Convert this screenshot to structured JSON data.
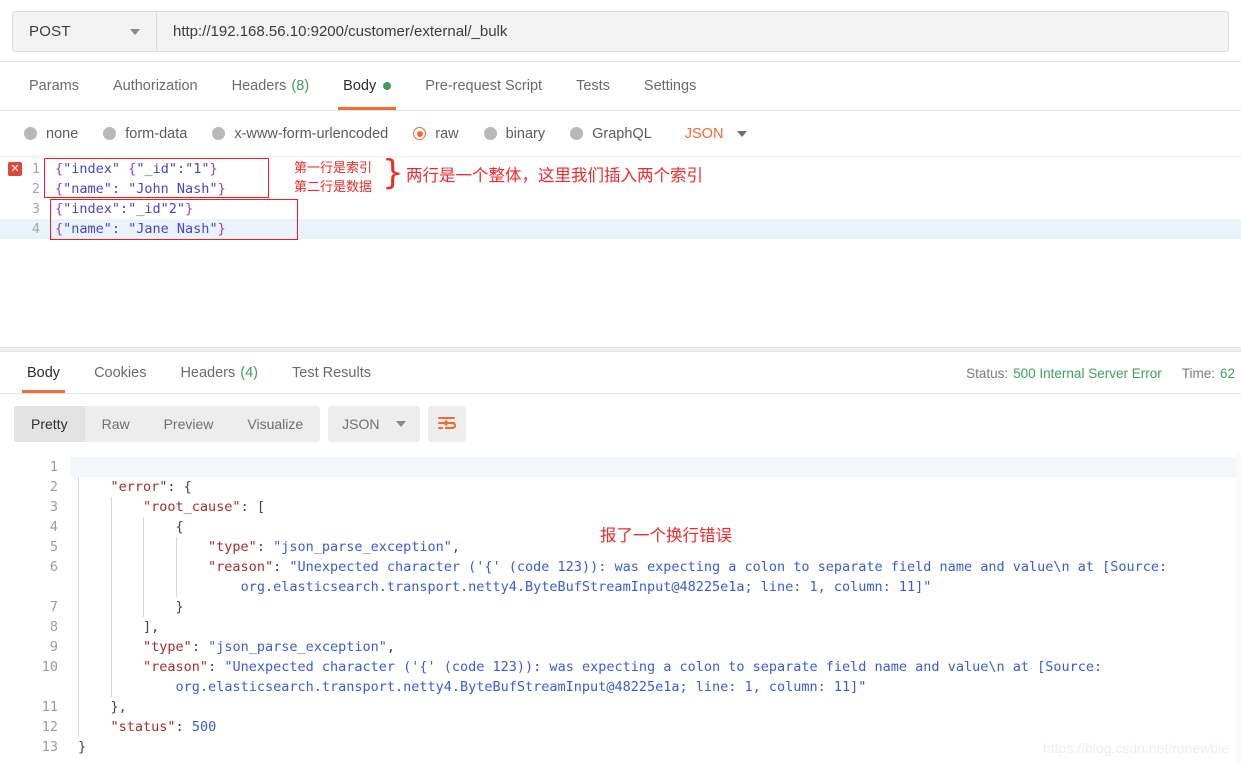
{
  "request": {
    "method": "POST",
    "url": "http://192.168.56.10:9200/customer/external/_bulk",
    "tabs": [
      {
        "label": "Params",
        "active": false,
        "count": null,
        "dot": false
      },
      {
        "label": "Authorization",
        "active": false,
        "count": null,
        "dot": false
      },
      {
        "label": "Headers",
        "active": false,
        "count": "(8)",
        "dot": false
      },
      {
        "label": "Body",
        "active": true,
        "count": null,
        "dot": true
      },
      {
        "label": "Pre-request Script",
        "active": false,
        "count": null,
        "dot": false
      },
      {
        "label": "Tests",
        "active": false,
        "count": null,
        "dot": false
      },
      {
        "label": "Settings",
        "active": false,
        "count": null,
        "dot": false
      }
    ],
    "body_types": [
      {
        "label": "none",
        "selected": false
      },
      {
        "label": "form-data",
        "selected": false
      },
      {
        "label": "x-www-form-urlencoded",
        "selected": false
      },
      {
        "label": "raw",
        "selected": true
      },
      {
        "label": "binary",
        "selected": false
      },
      {
        "label": "GraphQL",
        "selected": false
      }
    ],
    "format_selected": "JSON",
    "editor_lines": [
      {
        "num": "1",
        "text": "{\"index\" {\"_id\":\"1\"}",
        "error": true,
        "highlight": false
      },
      {
        "num": "2",
        "text": "{\"name\": \"John Nash\"}",
        "error": false,
        "highlight": false
      },
      {
        "num": "3",
        "text": "{\"index\":\"_id\"2\"}",
        "error": false,
        "highlight": false
      },
      {
        "num": "4",
        "text": "{\"name\": \"Jane Nash\"}",
        "error": false,
        "highlight": true
      }
    ],
    "annotations": {
      "line1": "第一行是索引",
      "line2": "第二行是数据",
      "brace": "}",
      "main": "两行是一个整体，这里我们插入两个索引"
    }
  },
  "response": {
    "tabs": [
      {
        "label": "Body",
        "active": true,
        "count": null
      },
      {
        "label": "Cookies",
        "active": false,
        "count": null
      },
      {
        "label": "Headers",
        "active": false,
        "count": "(4)"
      },
      {
        "label": "Test Results",
        "active": false,
        "count": null
      }
    ],
    "status_key": "Status:",
    "status_value": "500 Internal Server Error",
    "time_key": "Time:",
    "time_value": "62",
    "view_modes": [
      {
        "label": "Pretty",
        "active": true
      },
      {
        "label": "Raw",
        "active": false
      },
      {
        "label": "Preview",
        "active": false
      },
      {
        "label": "Visualize",
        "active": false
      }
    ],
    "format_selected": "JSON",
    "annotation": "报了一个换行错误",
    "json_lines": [
      {
        "num": "1",
        "indent": 0,
        "segments": [
          {
            "t": "{",
            "c": "jpunc"
          }
        ],
        "wrap": null
      },
      {
        "num": "2",
        "indent": 1,
        "segments": [
          {
            "t": "\"error\"",
            "c": "jkey"
          },
          {
            "t": ": {",
            "c": "jpunc"
          }
        ],
        "wrap": null
      },
      {
        "num": "3",
        "indent": 2,
        "segments": [
          {
            "t": "\"root_cause\"",
            "c": "jkey"
          },
          {
            "t": ": [",
            "c": "jpunc"
          }
        ],
        "wrap": null
      },
      {
        "num": "4",
        "indent": 3,
        "segments": [
          {
            "t": "{",
            "c": "jpunc"
          }
        ],
        "wrap": null
      },
      {
        "num": "5",
        "indent": 4,
        "segments": [
          {
            "t": "\"type\"",
            "c": "jkey"
          },
          {
            "t": ": ",
            "c": "jpunc"
          },
          {
            "t": "\"json_parse_exception\"",
            "c": "jstr"
          },
          {
            "t": ",",
            "c": "jpunc"
          }
        ],
        "wrap": null
      },
      {
        "num": "6",
        "indent": 4,
        "segments": [
          {
            "t": "\"reason\"",
            "c": "jkey"
          },
          {
            "t": ": ",
            "c": "jpunc"
          },
          {
            "t": "\"Unexpected character ('{' (code 123)): was expecting a colon to separate field name and value\\n at [Source:",
            "c": "jstr"
          }
        ],
        "wrap": "org.elasticsearch.transport.netty4.ByteBufStreamInput@48225e1a; line: 1, column: 11]\""
      },
      {
        "num": "7",
        "indent": 3,
        "segments": [
          {
            "t": "}",
            "c": "jpunc"
          }
        ],
        "wrap": null
      },
      {
        "num": "8",
        "indent": 2,
        "segments": [
          {
            "t": "],",
            "c": "jpunc"
          }
        ],
        "wrap": null
      },
      {
        "num": "9",
        "indent": 2,
        "segments": [
          {
            "t": "\"type\"",
            "c": "jkey"
          },
          {
            "t": ": ",
            "c": "jpunc"
          },
          {
            "t": "\"json_parse_exception\"",
            "c": "jstr"
          },
          {
            "t": ",",
            "c": "jpunc"
          }
        ],
        "wrap": null
      },
      {
        "num": "10",
        "indent": 2,
        "segments": [
          {
            "t": "\"reason\"",
            "c": "jkey"
          },
          {
            "t": ": ",
            "c": "jpunc"
          },
          {
            "t": "\"Unexpected character ('{' (code 123)): was expecting a colon to separate field name and value\\n at [Source:",
            "c": "jstr"
          }
        ],
        "wrap": "org.elasticsearch.transport.netty4.ByteBufStreamInput@48225e1a; line: 1, column: 11]\""
      },
      {
        "num": "11",
        "indent": 1,
        "segments": [
          {
            "t": "},",
            "c": "jpunc"
          }
        ],
        "wrap": null
      },
      {
        "num": "12",
        "indent": 1,
        "segments": [
          {
            "t": "\"status\"",
            "c": "jkey"
          },
          {
            "t": ": ",
            "c": "jpunc"
          },
          {
            "t": "500",
            "c": "jnumv"
          }
        ],
        "wrap": null
      },
      {
        "num": "13",
        "indent": 0,
        "segments": [
          {
            "t": "}",
            "c": "jpunc"
          }
        ],
        "wrap": null
      }
    ]
  },
  "watermark": "https://blog.csdn.net/runewbie",
  "colors": {
    "accent": "#ef6c36",
    "success": "#3fa05c",
    "annotation": "#ee2b2b",
    "json_key": "#a03030",
    "json_string": "#3a5fcd"
  }
}
